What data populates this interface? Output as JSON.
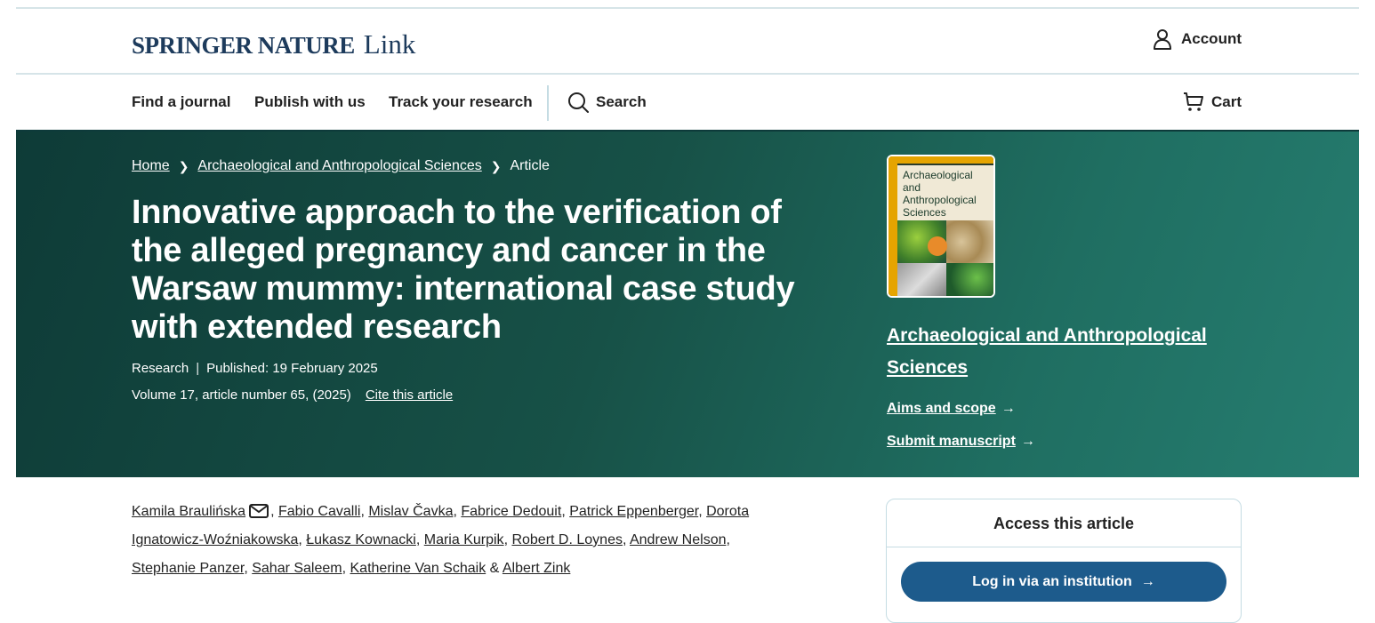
{
  "header": {
    "brand_name": "SPRINGER NATURE",
    "brand_product": "Link",
    "account_label": "Account"
  },
  "nav": {
    "items": [
      {
        "label": "Find a journal"
      },
      {
        "label": "Publish with us"
      },
      {
        "label": "Track your research"
      }
    ],
    "search_label": "Search",
    "cart_label": "Cart"
  },
  "breadcrumbs": [
    {
      "label": "Home"
    },
    {
      "label": "Archaeological and Anthropological Sciences"
    },
    {
      "label": "Article"
    }
  ],
  "article": {
    "title": "Innovative approach to the verification of the alleged pregnancy and cancer in the Warsaw mummy: international case study with extended research",
    "type": "Research",
    "published": "Published: 19 February 2025",
    "volume_line": "Volume 17, article number 65, (2025)",
    "cite_label": "Cite this article"
  },
  "journal": {
    "cover_title": "Archaeological and Anthropological Sciences",
    "name": "Archaeological and Anthropological Sciences",
    "aims_label": "Aims and scope",
    "submit_label": "Submit manuscript"
  },
  "authors": [
    "Kamila Braulińska",
    "Fabio Cavalli",
    "Mislav Čavka",
    "Fabrice Dedouit",
    "Patrick Eppenberger",
    "Dorota Ignatowicz-Woźniakowska",
    "Łukasz Kownacki",
    "Maria Kurpik",
    "Robert D. Loynes",
    "Andrew Nelson",
    "Stephanie Panzer",
    "Sahar Saleem",
    "Katherine Van Schaik",
    "Albert Zink"
  ],
  "access": {
    "heading": "Access this article",
    "login_label": "Log in via an institution"
  },
  "colors": {
    "brand_navy": "#1d3b5c",
    "hero_dark": "#0e3b37",
    "hero_light": "#267d70",
    "button_blue": "#1d5b8c"
  }
}
